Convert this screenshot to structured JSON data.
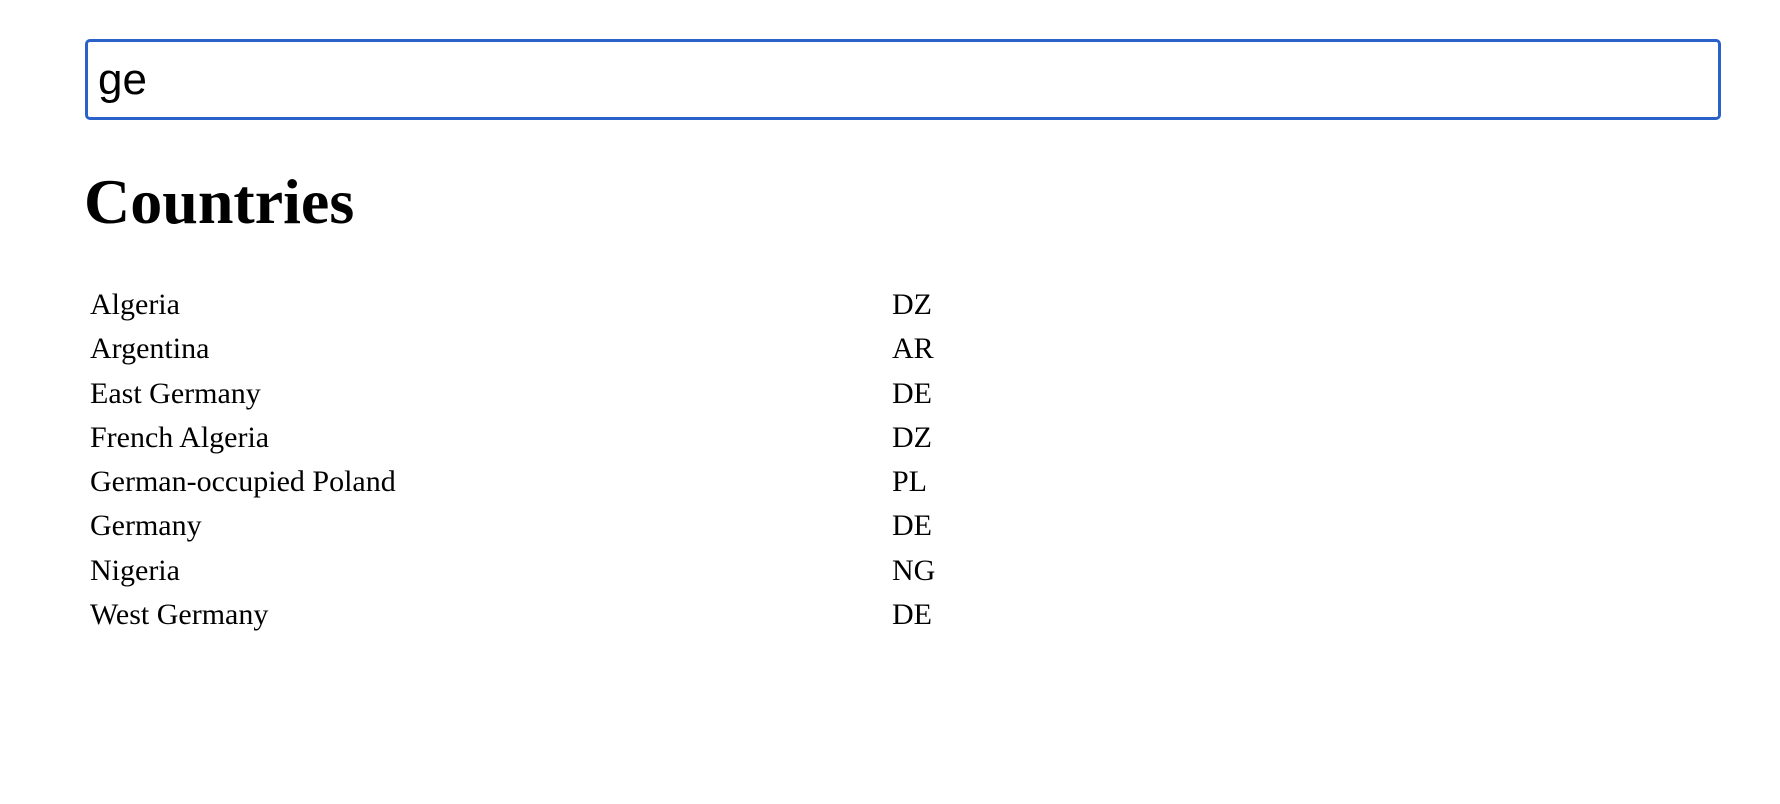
{
  "search": {
    "value": "ge",
    "accent_color": "#2a62c9"
  },
  "heading": "Countries",
  "countries": [
    {
      "name": "Algeria",
      "code": "DZ"
    },
    {
      "name": "Argentina",
      "code": "AR"
    },
    {
      "name": "East Germany",
      "code": "DE"
    },
    {
      "name": "French Algeria",
      "code": "DZ"
    },
    {
      "name": "German-occupied Poland",
      "code": "PL"
    },
    {
      "name": "Germany",
      "code": "DE"
    },
    {
      "name": "Nigeria",
      "code": "NG"
    },
    {
      "name": "West Germany",
      "code": "DE"
    }
  ]
}
